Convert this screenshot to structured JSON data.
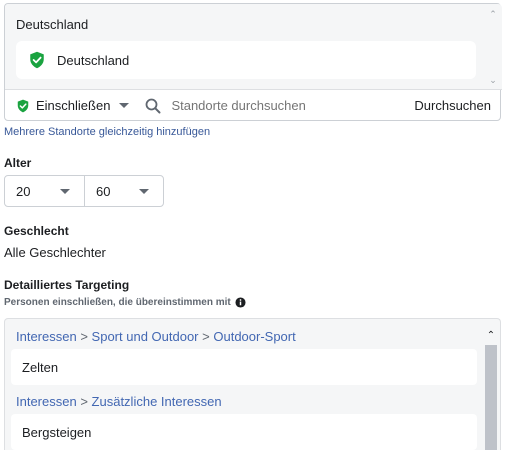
{
  "location": {
    "country_label": "Deutschland",
    "selected_item": "Deutschland",
    "include_label": "Einschließen",
    "search_placeholder": "Standorte durchsuchen",
    "browse_label": "Durchsuchen",
    "multi_link": "Mehrere Standorte gleichzeitig hinzufügen"
  },
  "age": {
    "title": "Alter",
    "min": "20",
    "max": "60"
  },
  "gender": {
    "title": "Geschlecht",
    "value": "Alle Geschlechter"
  },
  "targeting": {
    "title": "Detailliertes Targeting",
    "subtitle": "Personen einschließen, die übereinstimmen mit",
    "groups": [
      {
        "path": [
          "Interessen",
          "Sport und Outdoor",
          "Outdoor-Sport"
        ],
        "item": "Zelten"
      },
      {
        "path": [
          "Interessen",
          "Zusätzliche Interessen"
        ],
        "item": "Bergsteigen"
      }
    ],
    "separator": ">"
  },
  "colors": {
    "accent_green": "#1aa340",
    "link_blue": "#4267b2",
    "text": "#1c1e21"
  }
}
